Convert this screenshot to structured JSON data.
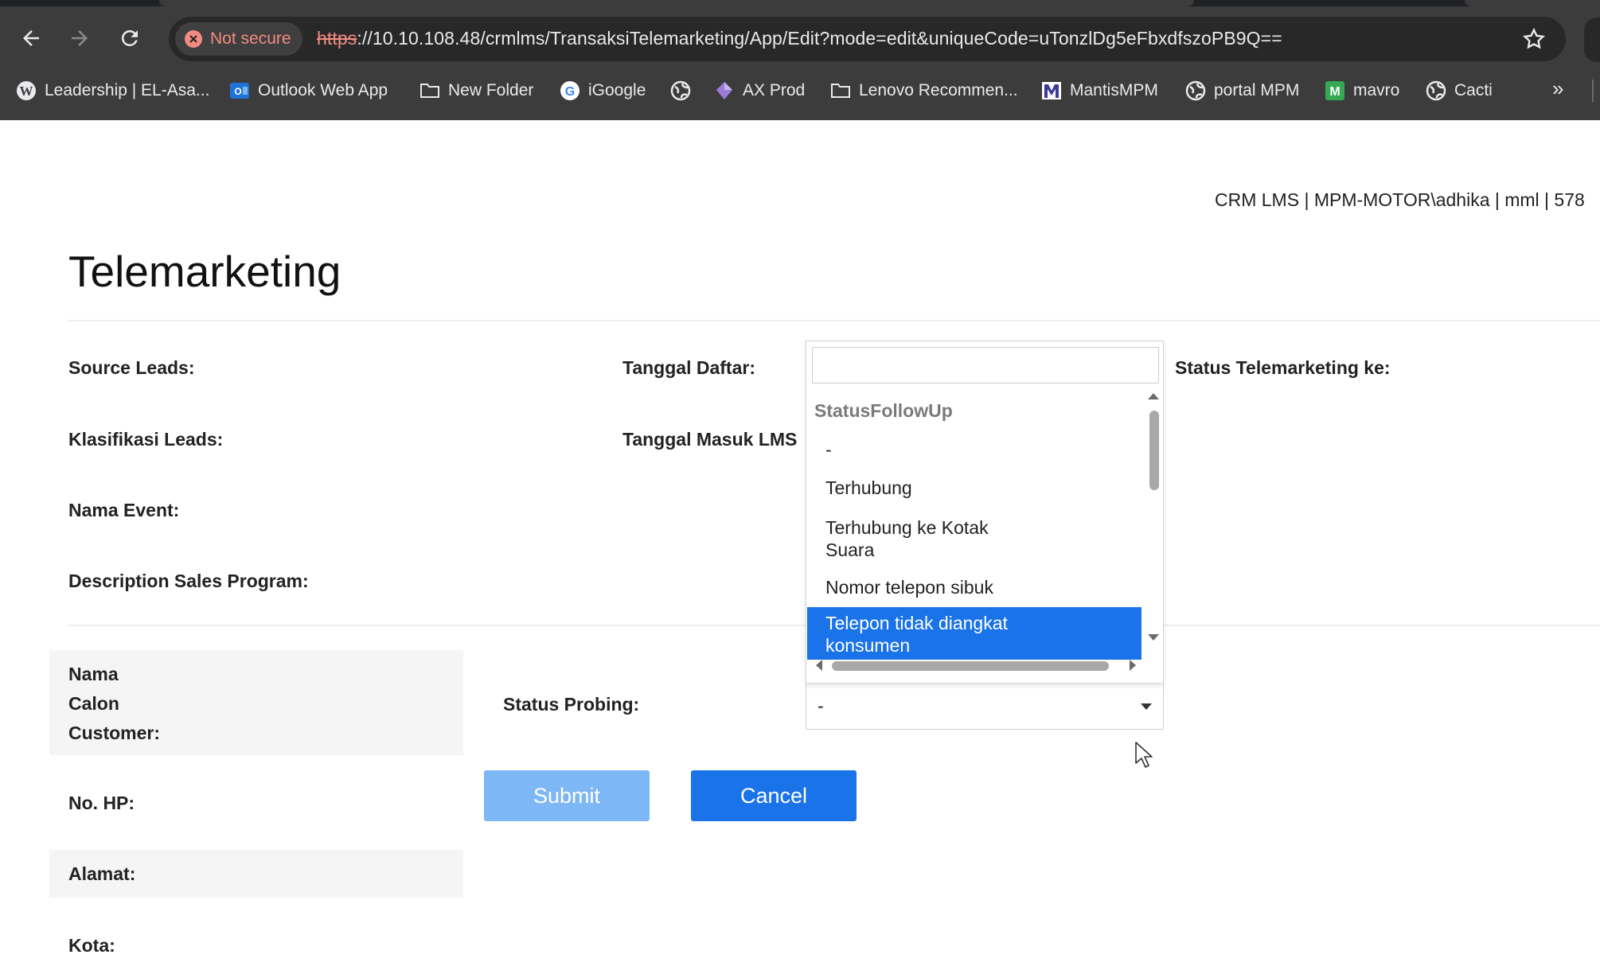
{
  "browser": {
    "security_label": "Not secure",
    "url_scheme": "https",
    "url_rest": "://10.10.108.48/crmlms/TransaksiTelemarketing/App/Edit?mode=edit&uniqueCode=uTonzlDg5eFbxdfszoPB9Q==",
    "bookmarks": [
      {
        "label": "Leadership | EL-Asa...",
        "icon": "wordpress-icon"
      },
      {
        "label": "Outlook Web App",
        "icon": "outlook-icon"
      },
      {
        "label": "New Folder",
        "icon": "folder-icon"
      },
      {
        "label": "iGoogle",
        "icon": "google-icon"
      },
      {
        "label": "",
        "icon": "globe-icon"
      },
      {
        "label": "AX Prod",
        "icon": "ax-prod-icon"
      },
      {
        "label": "Lenovo Recommen...",
        "icon": "folder-icon"
      },
      {
        "label": "MantisMPM",
        "icon": "mantis-icon"
      },
      {
        "label": "portal MPM",
        "icon": "globe-icon"
      },
      {
        "label": "mavro",
        "icon": "m-icon"
      },
      {
        "label": "Cacti",
        "icon": "globe-icon"
      }
    ],
    "more_label": "»"
  },
  "page": {
    "top_info": "CRM LMS | MPM-MOTOR\\adhika | mml | 578",
    "title": "Telemarketing",
    "labels": {
      "source_leads": "Source Leads:",
      "klasifikasi_leads": "Klasifikasi Leads:",
      "nama_event": "Nama Event:",
      "description_sales_program": "Description Sales Program:",
      "tanggal_daftar": "Tanggal Daftar:",
      "tanggal_masuk_lms": "Tanggal Masuk LMS",
      "status_telemarketing_ke": "Status Telemarketing ke:",
      "nama_line1": "Nama",
      "nama_line2": "Calon",
      "nama_line3": "Customer:",
      "no_hp": "No. HP:",
      "alamat": "Alamat:",
      "kota": "Kota:",
      "status_probing": "Status Probing:"
    },
    "buttons": {
      "submit": "Submit",
      "cancel": "Cancel"
    },
    "status_probing_select": {
      "selected": "-"
    },
    "dropdown": {
      "search_value": "",
      "group_label": "StatusFollowUp",
      "options": [
        {
          "line1": "-",
          "line2": ""
        },
        {
          "line1": "Terhubung",
          "line2": ""
        },
        {
          "line1": "Terhubung ke Kotak",
          "line2": "Suara"
        },
        {
          "line1": "Nomor telepon sibuk",
          "line2": ""
        },
        {
          "line1": "Telepon tidak diangkat",
          "line2": "konsumen"
        }
      ],
      "highlighted_index": 4,
      "highlight_color": "#1a73e8"
    }
  }
}
